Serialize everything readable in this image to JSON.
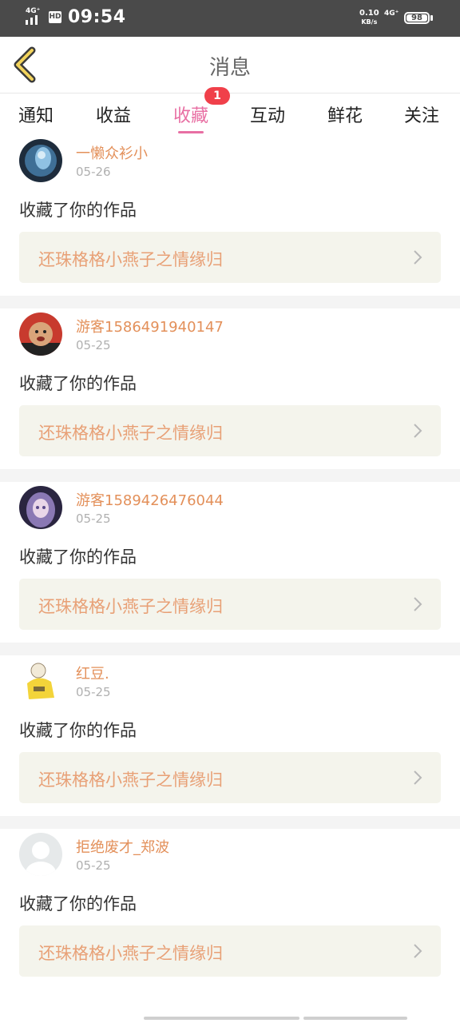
{
  "status_bar": {
    "signal_label": "4G⁺",
    "hd": "HD",
    "time": "09:54",
    "speed_value": "0.10",
    "speed_unit": "KB/s",
    "network2": "4G⁺",
    "battery": "98"
  },
  "header": {
    "back_icon": "chevron-left-icon",
    "title": "消息"
  },
  "tabs": [
    {
      "label": "通知",
      "active": false
    },
    {
      "label": "收益",
      "active": false
    },
    {
      "label": "收藏",
      "active": true,
      "badge": "1"
    },
    {
      "label": "互动",
      "active": false
    },
    {
      "label": "鲜花",
      "active": false
    },
    {
      "label": "关注",
      "active": false
    }
  ],
  "colors": {
    "accent": "#e86fa3",
    "badge": "#f0404a",
    "username": "#e3905a",
    "work_title": "#e8a076",
    "work_bg": "#f4f4ec"
  },
  "feed": [
    {
      "username": "一懒众衫小",
      "date": "05-26",
      "action": "收藏了你的作品",
      "work_title": "还珠格格小燕子之情缘归"
    },
    {
      "username": "游客1586491940147",
      "date": "05-25",
      "action": "收藏了你的作品",
      "work_title": "还珠格格小燕子之情缘归"
    },
    {
      "username": "游客1589426476044",
      "date": "05-25",
      "action": "收藏了你的作品",
      "work_title": "还珠格格小燕子之情缘归"
    },
    {
      "username": "红豆.",
      "date": "05-25",
      "action": "收藏了你的作品",
      "work_title": "还珠格格小燕子之情缘归"
    },
    {
      "username": "拒绝废才_郑波",
      "date": "05-25",
      "action": "收藏了你的作品",
      "work_title": "还珠格格小燕子之情缘归"
    }
  ]
}
